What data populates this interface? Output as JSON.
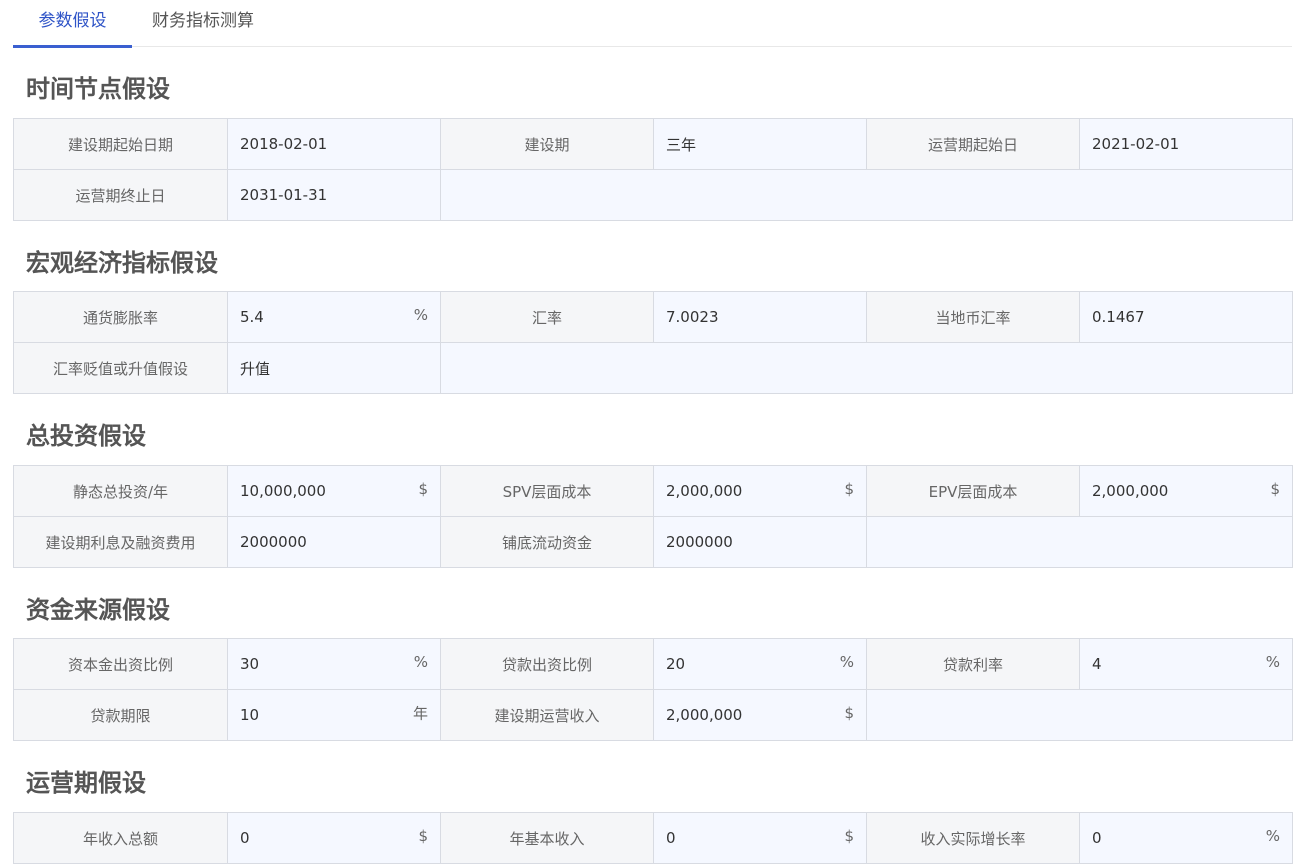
{
  "tabs": [
    "参数假设",
    "财务指标测算"
  ],
  "sections": [
    {
      "title": "时间节点假设",
      "rows": [
        [
          {
            "label": "建设期起始日期",
            "value": "2018-02-01",
            "unit": ""
          },
          {
            "label": "建设期",
            "value": "三年",
            "unit": ""
          },
          {
            "label": "运营期起始日",
            "value": "2021-02-01",
            "unit": ""
          }
        ],
        [
          {
            "label": "运营期终止日",
            "value": "2031-01-31",
            "unit": ""
          }
        ]
      ]
    },
    {
      "title": "宏观经济指标假设",
      "rows": [
        [
          {
            "label": "通货膨胀率",
            "value": "5.4",
            "unit": "%"
          },
          {
            "label": "汇率",
            "value": "7.0023",
            "unit": ""
          },
          {
            "label": "当地币汇率",
            "value": "0.1467",
            "unit": ""
          }
        ],
        [
          {
            "label": "汇率贬值或升值假设",
            "value": "升值",
            "unit": ""
          }
        ]
      ]
    },
    {
      "title": "总投资假设",
      "rows": [
        [
          {
            "label": "静态总投资/年",
            "value": "10,000,000",
            "unit": "$"
          },
          {
            "label": "SPV层面成本",
            "value": "2,000,000",
            "unit": "$"
          },
          {
            "label": "EPV层面成本",
            "value": "2,000,000",
            "unit": "$"
          }
        ],
        [
          {
            "label": "建设期利息及融资费用",
            "value": "2000000",
            "unit": ""
          },
          {
            "label": "铺底流动资金",
            "value": "2000000",
            "unit": ""
          }
        ]
      ]
    },
    {
      "title": "资金来源假设",
      "rows": [
        [
          {
            "label": "资本金出资比例",
            "value": "30",
            "unit": "%"
          },
          {
            "label": "贷款出资比例",
            "value": "20",
            "unit": "%"
          },
          {
            "label": "贷款利率",
            "value": "4",
            "unit": "%"
          }
        ],
        [
          {
            "label": "贷款期限",
            "value": "10",
            "unit": "年"
          },
          {
            "label": "建设期运营收入",
            "value": "2,000,000",
            "unit": "$"
          }
        ]
      ]
    },
    {
      "title": "运营期假设",
      "rows": [
        [
          {
            "label": "年收入总额",
            "value": "0",
            "unit": "$"
          },
          {
            "label": "年基本收入",
            "value": "0",
            "unit": "$"
          },
          {
            "label": "收入实际增长率",
            "value": "0",
            "unit": "%"
          }
        ]
      ]
    }
  ]
}
